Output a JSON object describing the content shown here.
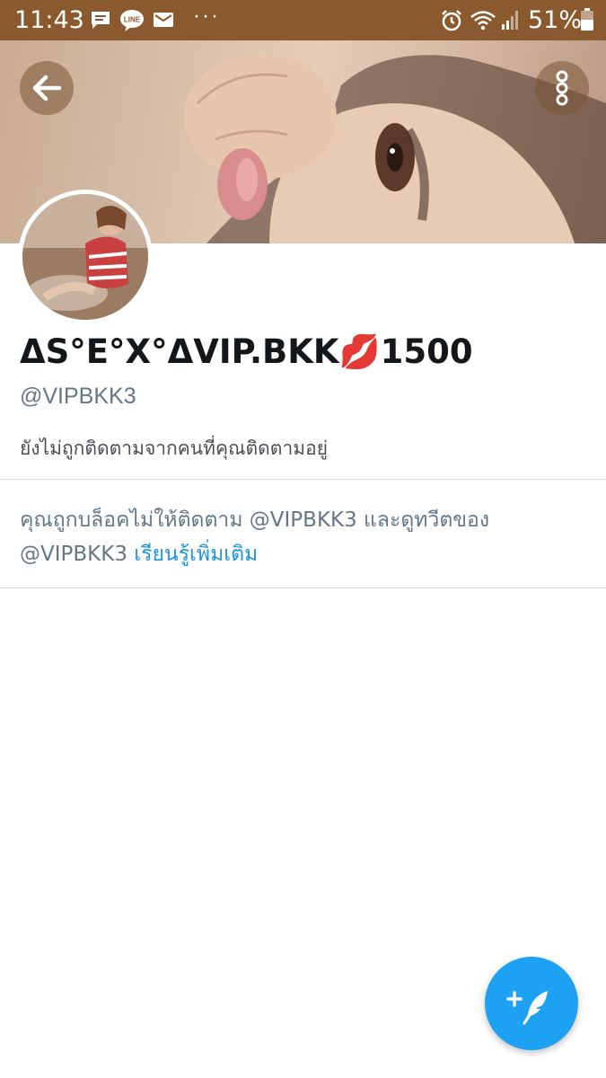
{
  "status_bar": {
    "time": "11:43",
    "dots": "···",
    "battery_percent": "51%",
    "background_color": "#8a5a2e",
    "left_icons": [
      "message-icon",
      "line-icon",
      "mail-icon"
    ],
    "right_icons": [
      "alarm-icon",
      "wifi-icon",
      "signal-icon",
      "battery-icon"
    ]
  },
  "header": {
    "back_icon": "arrow-left-icon",
    "menu_icon": "more-vertical-icon"
  },
  "profile": {
    "display_name": "ΔS°E°X°ΔVIP.BKK💋1500",
    "handle": "@VIPBKK3",
    "followers_note": "ยังไม่ถูกติดตามจากคนที่คุณติดตามอยู่"
  },
  "blocked_notice": {
    "text_line1": "คุณถูกบล็อคไม่ให้ติดตาม @VIPBKK3 และดูทวีตของ",
    "text_line2": "@VIPBKK3",
    "learn_more": "เรียนรู้เพิ่มเติม"
  },
  "fab": {
    "icon": "compose-tweet-icon",
    "color": "#1da1f2"
  },
  "colors": {
    "link": "#1b95e0",
    "secondary_text": "#657786",
    "primary_text": "#14171a"
  }
}
